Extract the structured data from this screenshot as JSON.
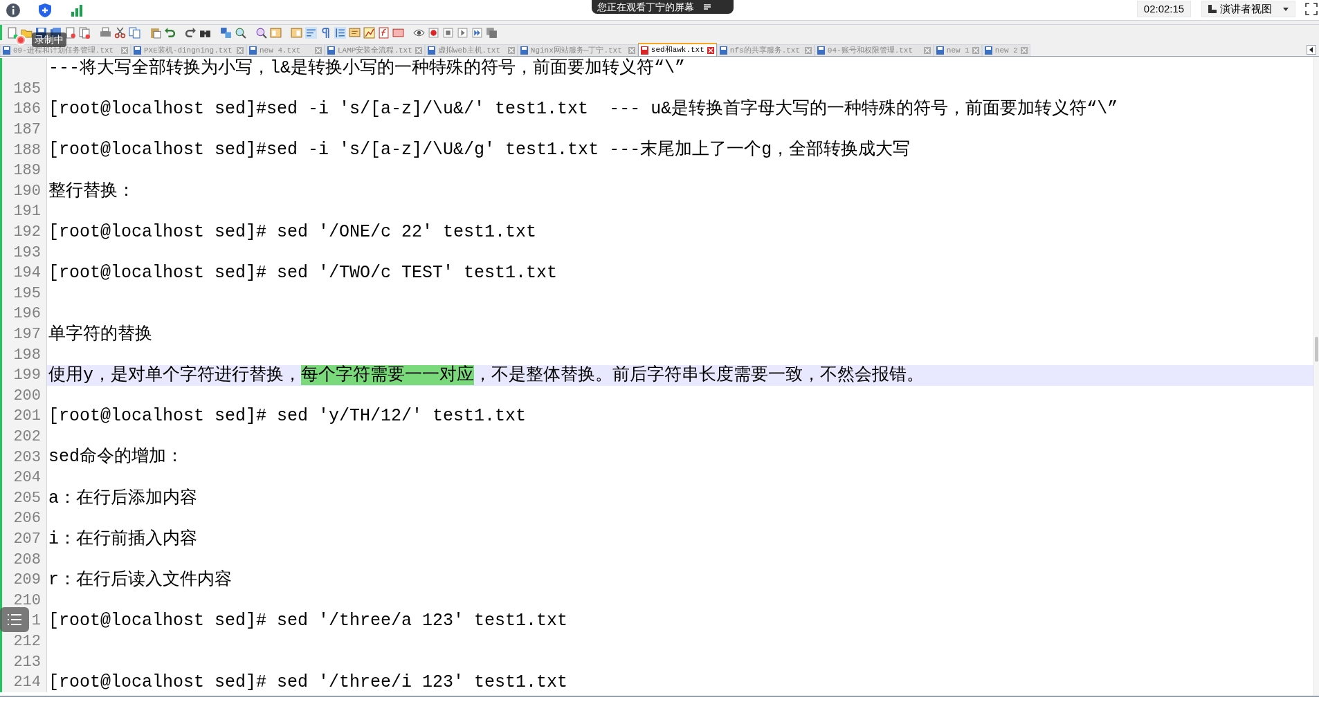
{
  "top_bar": {
    "share_banner": "您正在观看丁宁的屏幕",
    "clock": "02:02:15",
    "presenter_view": "演讲者视图"
  },
  "recording_badge": "录制中",
  "tabs": [
    {
      "label": "09-进程和计划任务管理.txt",
      "selected": false
    },
    {
      "label": "PXE装机-dingning.txt",
      "selected": false
    },
    {
      "label": "new 4.txt",
      "selected": false
    },
    {
      "label": "LAMP安装全流程.txt",
      "selected": false
    },
    {
      "label": "虚拟web主机.txt",
      "selected": false
    },
    {
      "label": "Nginx网站服务—丁宁.txt",
      "selected": false
    },
    {
      "label": "sed和awk.txt",
      "selected": true
    },
    {
      "label": "nfs的共享服务.txt",
      "selected": false
    },
    {
      "label": "04-账号和权限管理.txt",
      "selected": false
    },
    {
      "label": "new 1",
      "selected": false
    },
    {
      "label": "new 2",
      "selected": false
    }
  ],
  "editor": {
    "lines": [
      {
        "text": "---将大写全部转换为小写，l&是转换小写的一种特殊的符号，前面要加转义符“\\”",
        "current": false
      },
      {
        "number": "185",
        "current": false
      },
      {
        "number": "186",
        "text": "[root@localhost sed]#sed -i 's/[a-z]/\\u&/' test1.txt  --- u&是转换首字母大写的一种特殊的符号，前面要加转义符“\\”",
        "current": false
      },
      {
        "number": "187",
        "current": false
      },
      {
        "number": "188",
        "text": "[root@localhost sed]#sed -i 's/[a-z]/\\U&/g' test1.txt ---末尾加上了一个g，全部转换成大写",
        "current": false
      },
      {
        "number": "189",
        "current": false
      },
      {
        "number": "190",
        "text": "整行替换：",
        "current": false
      },
      {
        "number": "191",
        "current": false
      },
      {
        "number": "192",
        "text": "[root@localhost sed]# sed '/ONE/c 22' test1.txt",
        "current": false
      },
      {
        "number": "193",
        "current": false
      },
      {
        "number": "194",
        "text": "[root@localhost sed]# sed '/TWO/c TEST' test1.txt",
        "current": false
      },
      {
        "number": "195",
        "current": false
      },
      {
        "number": "196",
        "current": false
      },
      {
        "number": "197",
        "text": "单字符的替换",
        "current": false
      },
      {
        "number": "198",
        "current": false
      },
      {
        "number": "199",
        "segments": [
          {
            "text": "使用y，是对单个字符进行替换，",
            "highlighted": false
          },
          {
            "text": "每个字符需要一一对应",
            "highlighted": true
          },
          {
            "text": "，不是整体替换。前后字符串长度需要一致，不然会报错。",
            "highlighted": false
          }
        ],
        "current": true
      },
      {
        "number": "200",
        "current": false
      },
      {
        "number": "201",
        "text": "[root@localhost sed]# sed 'y/TH/12/' test1.txt",
        "current": false
      },
      {
        "number": "202",
        "current": false
      },
      {
        "number": "203",
        "text": "sed命令的增加：",
        "current": false
      },
      {
        "number": "204",
        "current": false
      },
      {
        "number": "205",
        "text": "a：在行后添加内容",
        "current": false
      },
      {
        "number": "206",
        "current": false
      },
      {
        "number": "207",
        "text": "i：在行前插入内容",
        "current": false
      },
      {
        "number": "208",
        "current": false
      },
      {
        "number": "209",
        "text": "r：在行后读入文件内容",
        "current": false
      },
      {
        "number": "210",
        "current": false
      },
      {
        "number": "1",
        "text": "[root@localhost sed]# sed '/three/a 123' test1.txt",
        "current": false
      },
      {
        "number": "212",
        "current": false
      },
      {
        "number": "213",
        "current": false
      },
      {
        "number": "214",
        "text": "[root@localhost sed]# sed '/three/i 123' test1.txt",
        "current": false
      }
    ]
  }
}
